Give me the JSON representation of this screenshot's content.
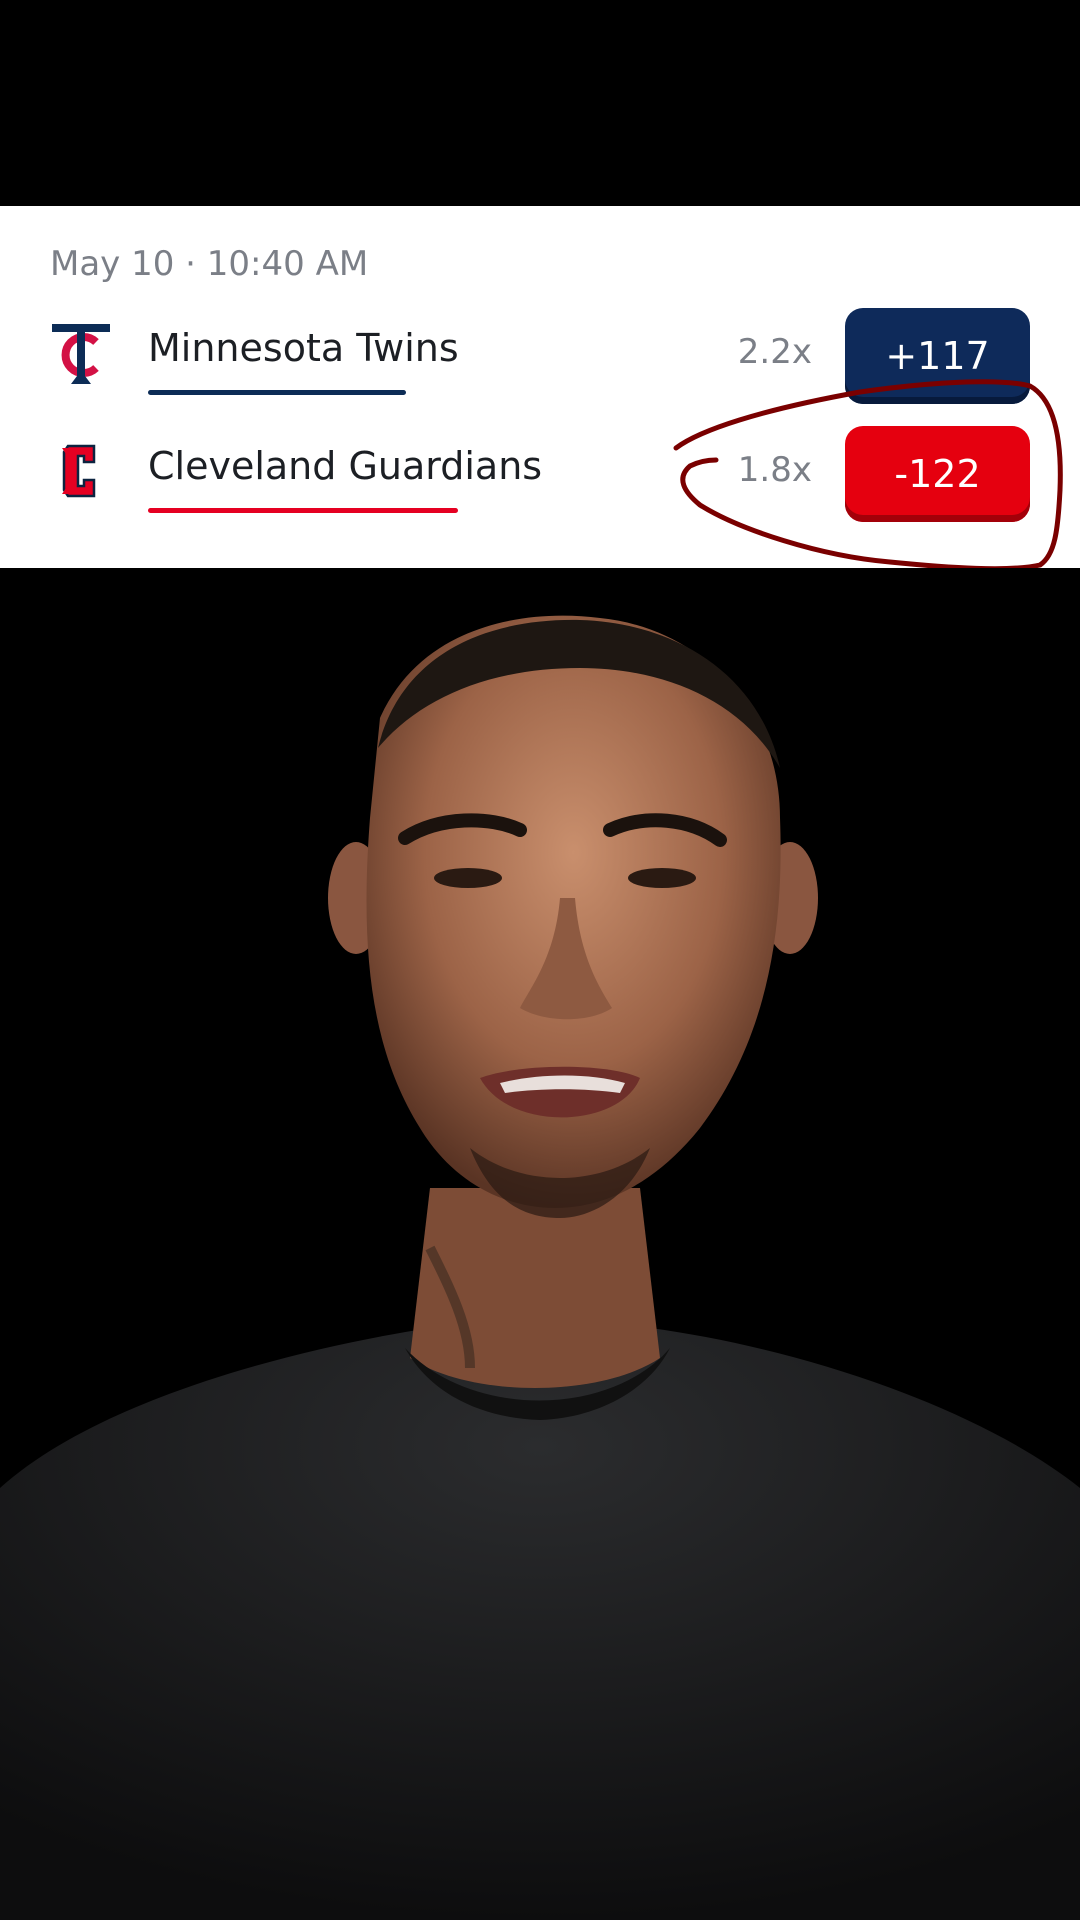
{
  "game": {
    "datetime": "May 10 · 10:40 AM"
  },
  "teams": [
    {
      "name": "Minnesota Twins",
      "multiplier": "2.2x",
      "odds": "+117",
      "color": "#0c2c56"
    },
    {
      "name": "Cleveland Guardians",
      "multiplier": "1.8x",
      "odds": "-122",
      "color": "#e50022"
    }
  ],
  "icons": {
    "twins_logo": "twins-tc-logo-icon",
    "guardians_logo": "guardians-c-logo-icon"
  },
  "annotation_color": "#7a0000"
}
